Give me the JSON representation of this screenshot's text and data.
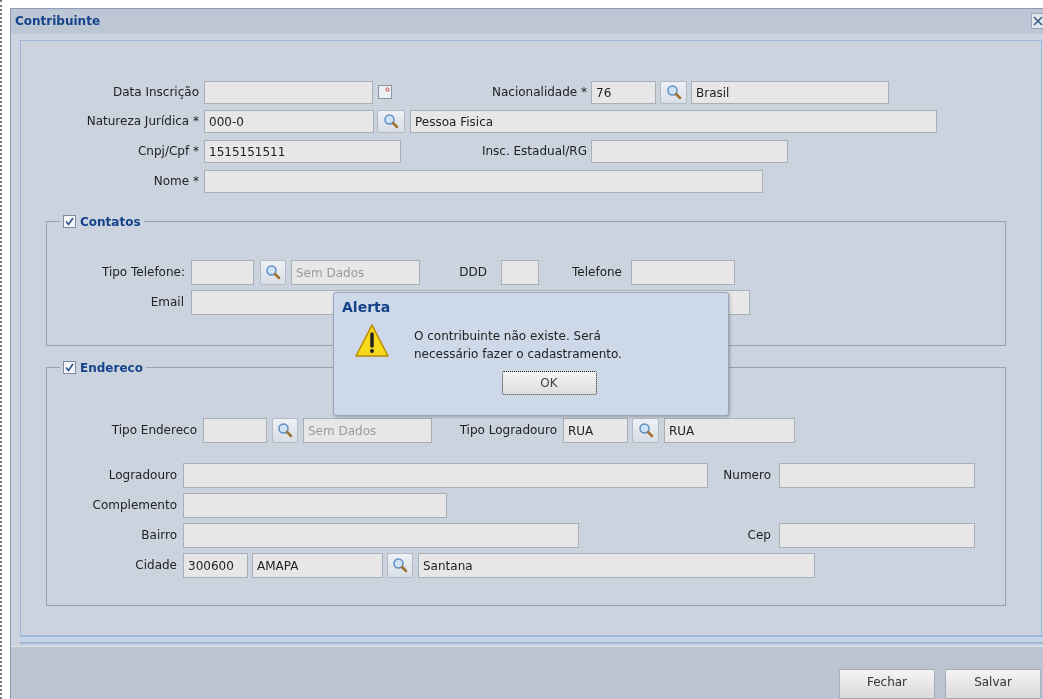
{
  "window": {
    "title": "Contribuinte"
  },
  "form": {
    "rows": [
      [
        {
          "kind": "label",
          "text": "Data Inscrição"
        },
        {
          "kind": "date"
        },
        {
          "kind": "label",
          "text": "Nacionalidade *"
        },
        {
          "kind": "field",
          "value": "76"
        },
        {
          "kind": "search"
        },
        {
          "kind": "field",
          "value": "Brasil"
        }
      ],
      [
        {
          "kind": "label",
          "text": "Natureza Jurídica *"
        },
        {
          "kind": "field",
          "value": "000-0"
        },
        {
          "kind": "search"
        },
        {
          "kind": "field",
          "value": "Pessoa Fisica"
        }
      ],
      [
        {
          "kind": "label",
          "text": "Cnpj/Cpf *"
        },
        {
          "kind": "field",
          "value": "1515151511"
        },
        {
          "kind": "label",
          "text": "Insc. Estadual/RG"
        },
        {
          "kind": "field"
        }
      ],
      [
        {
          "kind": "label",
          "text": "Nome *"
        },
        {
          "kind": "field"
        }
      ]
    ]
  },
  "sections": [
    {
      "title": "Contatos",
      "checked": true,
      "rows": [
        [
          {
            "kind": "label",
            "text": "Tipo Telefone:"
          },
          {
            "kind": "field"
          },
          {
            "kind": "search"
          },
          {
            "kind": "field",
            "placeholder": "Sem Dados"
          },
          {
            "kind": "label",
            "text": "DDD"
          },
          {
            "kind": "field"
          },
          {
            "kind": "label",
            "text": "Telefone"
          },
          {
            "kind": "field"
          }
        ],
        [
          {
            "kind": "label",
            "text": "Email"
          },
          {
            "kind": "field"
          }
        ]
      ]
    },
    {
      "title": "Endereco",
      "checked": true,
      "rows": [
        [
          {
            "kind": "label",
            "text": "Tipo Endereco"
          },
          {
            "kind": "field"
          },
          {
            "kind": "search"
          },
          {
            "kind": "field",
            "placeholder": "Sem Dados"
          },
          {
            "kind": "label",
            "text": "Tipo Logradouro"
          },
          {
            "kind": "field",
            "value": "RUA"
          },
          {
            "kind": "search"
          },
          {
            "kind": "field",
            "value": "RUA"
          }
        ],
        [
          {
            "kind": "label",
            "text": "Logradouro"
          },
          {
            "kind": "field"
          },
          {
            "kind": "label",
            "text": "Numero"
          },
          {
            "kind": "field"
          }
        ],
        [
          {
            "kind": "label",
            "text": "Complemento"
          },
          {
            "kind": "field"
          }
        ],
        [
          {
            "kind": "label",
            "text": "Bairro"
          },
          {
            "kind": "field"
          },
          {
            "kind": "label",
            "text": "Cep"
          },
          {
            "kind": "field"
          }
        ],
        [
          {
            "kind": "label",
            "text": "Cidade"
          },
          {
            "kind": "field",
            "value": "300600"
          },
          {
            "kind": "field",
            "value": "AMAPA"
          },
          {
            "kind": "search"
          },
          {
            "kind": "field",
            "value": "Santana"
          }
        ]
      ]
    }
  ],
  "buttons": [
    "Fechar",
    "Salvar"
  ],
  "alert": {
    "title": "Alerta",
    "message": "O contribuinte não existe. Será necessário fazer o cadastramento.",
    "button": "OK"
  }
}
